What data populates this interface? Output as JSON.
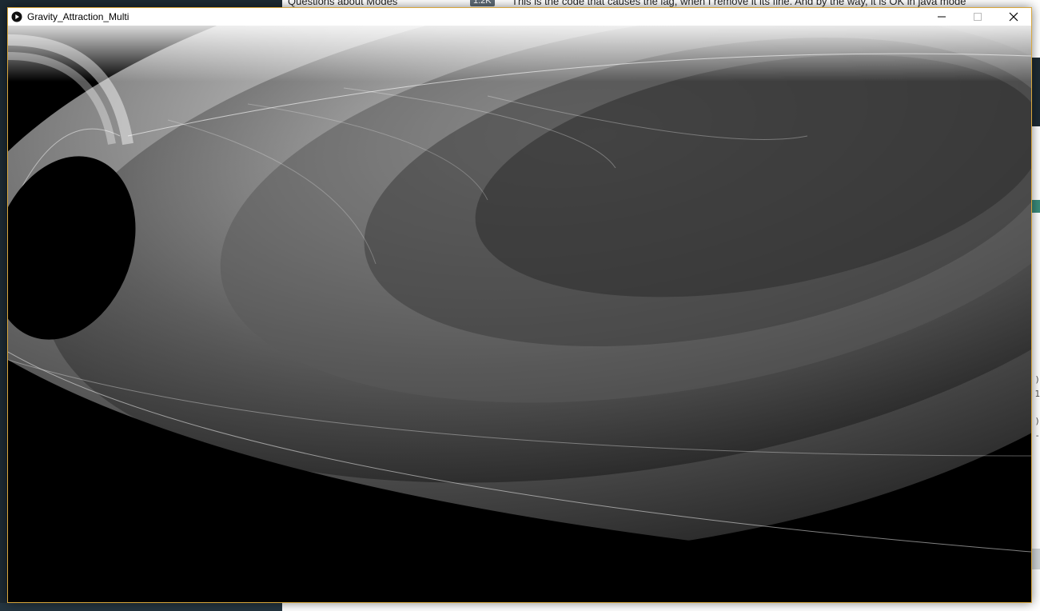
{
  "background_page": {
    "question_title": "Questions about Modes",
    "count_badge": "1.2K",
    "post_text": "This is the code that causes the lag, when I remove it its fine. And by the way, it is OK in java mode",
    "code_fragments": [
      ")",
      "1",
      ")",
      "-"
    ]
  },
  "window": {
    "title": "Gravity_Attraction_Multi",
    "app_icon": "processing-play-icon",
    "minimize_icon": "minimize-icon",
    "maximize_icon": "maximize-icon",
    "close_icon": "close-icon"
  },
  "canvas": {
    "background_color": "#000000",
    "stroke_color": "#ffffff"
  }
}
